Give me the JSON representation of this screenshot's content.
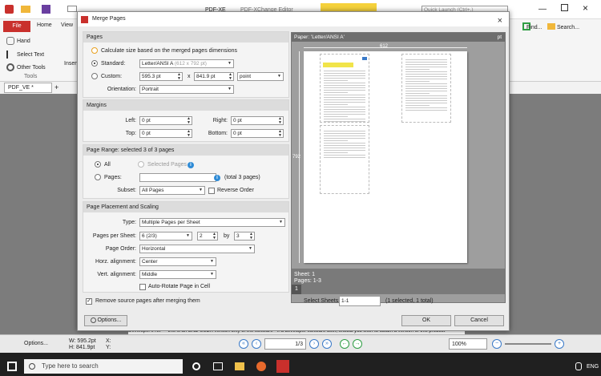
{
  "app": {
    "title_left": "PDF-XE",
    "title_center": "PDF-XChange Editor",
    "quick_launch": "Quick Launch (Ctrl+.)",
    "file_tab": "File",
    "tabs": [
      "Home",
      "View"
    ],
    "tools": {
      "hand": "Hand",
      "select_text": "Select Text",
      "other_tools": "Other Tools",
      "group_label": "Tools",
      "insert": "Insert"
    },
    "right_tools": {
      "find": "Find...",
      "search": "Search..."
    },
    "doc_tab": "PDF_VE *",
    "banner": "Developer's Kit — this is an END USER version only of the software - if a developer software user, should you wish to obtain a version of this product",
    "status": {
      "options": "Options...",
      "width": "W: 595.2pt",
      "height": "H: 841.9pt",
      "x": "X:",
      "y": "Y:",
      "page_box": "1/3",
      "zoom": "100%"
    }
  },
  "taskbar": {
    "search_placeholder": "Type here to search",
    "lang": "ENG"
  },
  "dialog": {
    "title": "Merge Pages",
    "close": "×",
    "pages": {
      "header": "Pages",
      "calc_label": "Calculate size based on the merged pages dimensions",
      "standard_label": "Standard:",
      "standard_value": "Letter/ANSI A",
      "standard_dims": "(612 x 792 pt)",
      "custom_label": "Custom:",
      "custom_w": "595.3 pt",
      "x_sep": "x",
      "custom_h": "841.9 pt",
      "unit": "point",
      "orientation_label": "Orientation:",
      "orientation_value": "Portrait"
    },
    "margins": {
      "header": "Margins",
      "left_label": "Left:",
      "left_value": "0 pt",
      "right_label": "Right:",
      "right_value": "0 pt",
      "top_label": "Top:",
      "top_value": "0 pt",
      "bottom_label": "Bottom:",
      "bottom_value": "0 pt"
    },
    "range": {
      "header": "Page Range: selected 3 of 3 pages",
      "all_label": "All",
      "selected_label": "Selected Pages",
      "pages_label": "Pages:",
      "pages_value": "",
      "total_label": "(total 3 pages)",
      "subset_label": "Subset:",
      "subset_value": "All Pages",
      "reverse_label": "Reverse Order"
    },
    "placement": {
      "header": "Page Placement and Scaling",
      "type_label": "Type:",
      "type_value": "Multiple Pages per Sheet",
      "pps_label": "Pages per Sheet:",
      "pps_value": "6 (2/3)",
      "cols_value": "2",
      "by_label": "by",
      "rows_value": "3",
      "order_label": "Page Order:",
      "order_value": "Horizontal",
      "horz_label": "Horz. alignment:",
      "horz_value": "Center",
      "vert_label": "Vert. alignment:",
      "vert_value": "Middle",
      "autorotate_label": "Auto-Rotate Page in Cell"
    },
    "remove_label": "Remove source pages after merging them",
    "preview": {
      "paper_label": "Paper: 'Letter/ANSI A'",
      "unit": "pt",
      "width_ruler": "612",
      "height_ruler": "792",
      "sheet_label": "Sheet: 1",
      "pages_label": "Pages: 1-3",
      "sheet_num": "1"
    },
    "select_sheets_label": "Select Sheets:",
    "select_sheets_value": "1-1",
    "select_sheets_info": "(1 selected, 1 total)",
    "options_button": "Options...",
    "ok_button": "OK",
    "cancel_button": "Cancel"
  }
}
